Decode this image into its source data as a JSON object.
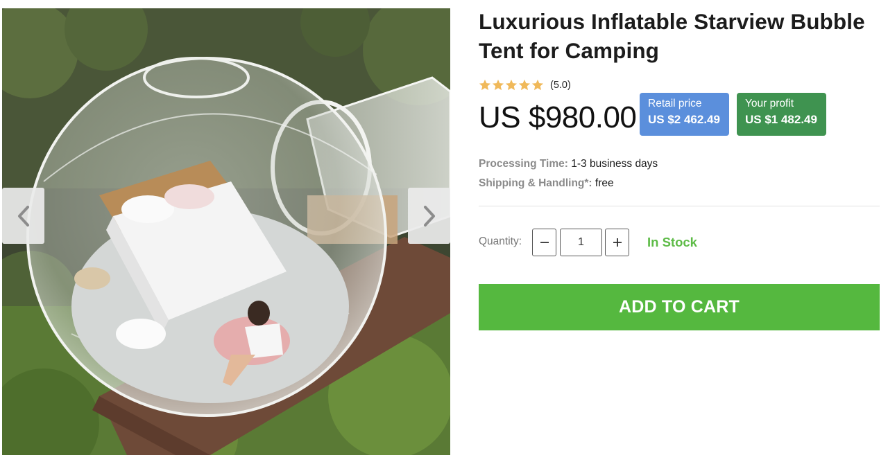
{
  "product": {
    "title": "Luxurious Inflatable Starview Bubble Tent for Camping",
    "rating": {
      "stars": 5,
      "value_text": "(5.0)"
    },
    "price": "US $980.00",
    "retail": {
      "label": "Retail price",
      "value": "US $2 462.49"
    },
    "profit": {
      "label": "Your profit",
      "value": "US $1 482.49"
    },
    "processing": {
      "label": "Processing Time:",
      "value": "1-3 business days"
    },
    "shipping": {
      "label": "Shipping & Handling*:",
      "value": "free"
    }
  },
  "quantity": {
    "label": "Quantity:",
    "value": "1",
    "minus_icon": "minus-icon",
    "plus_icon": "plus-icon"
  },
  "stock_status": "In Stock",
  "cart_button": "ADD TO CART",
  "gallery": {
    "prev_icon": "chevron-left-icon",
    "next_icon": "chevron-right-icon"
  },
  "colors": {
    "star": "#f0b95a",
    "retail_badge": "#5b8fdc",
    "profit_badge": "#3f9350",
    "in_stock": "#5dbb47",
    "cart_button": "#55b83f"
  }
}
